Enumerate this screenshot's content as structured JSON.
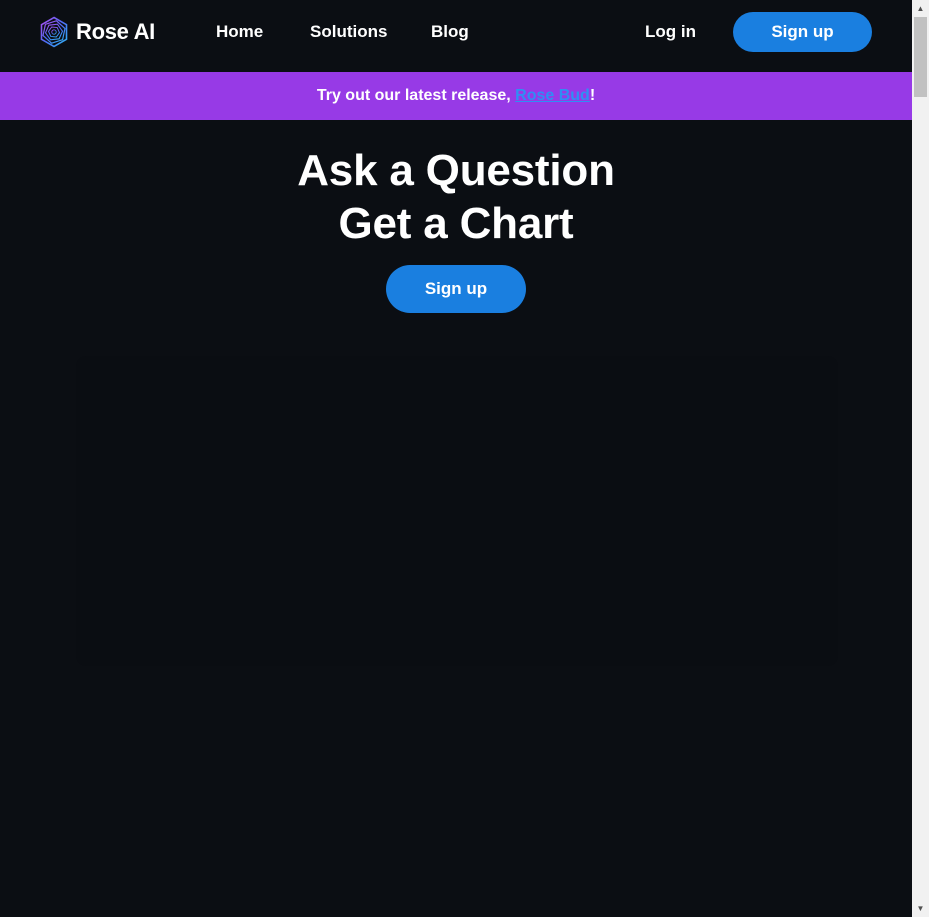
{
  "header": {
    "brand": {
      "name": "Rose AI",
      "logo_icon": "hexagon-spiral-logo-icon"
    },
    "nav": {
      "home": "Home",
      "solutions": "Solutions",
      "blog": "Blog"
    },
    "auth": {
      "login": "Log in",
      "signup": "Sign up"
    }
  },
  "banner": {
    "prefix": "Try out our latest release, ",
    "link": "Rose Bud",
    "suffix": "!"
  },
  "hero": {
    "line1": "Ask a Question",
    "line2": "Get a Chart",
    "cta": "Sign up"
  },
  "colors": {
    "background": "#0b0e13",
    "banner": "#973ae6",
    "primary_button": "#1a7fe0",
    "link": "#2f8ef4"
  },
  "scrollbar": {
    "up_icon": "scroll-up-arrow-icon",
    "down_icon": "scroll-down-arrow-icon"
  }
}
